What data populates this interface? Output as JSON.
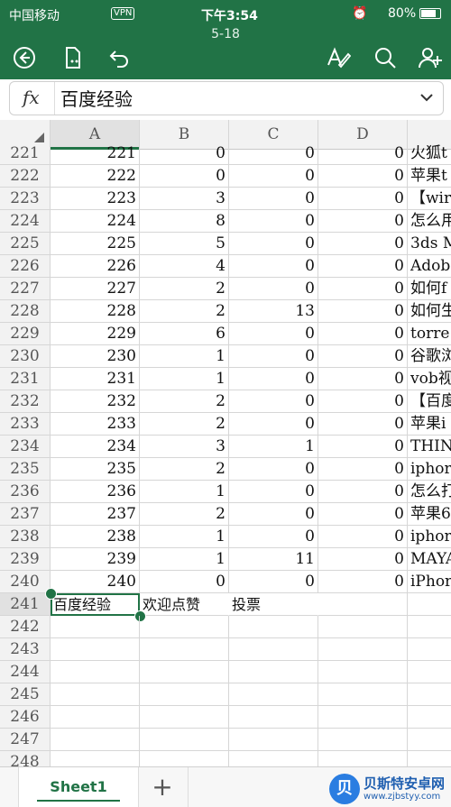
{
  "status_bar": {
    "carrier": "中国移动",
    "vpn": "VPN",
    "time": "下午3:54",
    "battery": "80%"
  },
  "document": {
    "title": "5-18"
  },
  "toolbar": {
    "back_icon": "back-circle-icon",
    "file_icon": "file-icon",
    "undo_icon": "undo-icon",
    "format_icon": "text-format-icon",
    "search_icon": "search-icon",
    "share_icon": "add-person-icon"
  },
  "formula_bar": {
    "fx": "fx",
    "value": "百度经验"
  },
  "columns": [
    "A",
    "B",
    "C",
    "D"
  ],
  "rows": [
    {
      "n": "221",
      "a": "221",
      "b": "0",
      "c": "0",
      "d": "0",
      "e": "火狐t"
    },
    {
      "n": "222",
      "a": "222",
      "b": "0",
      "c": "0",
      "d": "0",
      "e": "苹果t"
    },
    {
      "n": "223",
      "a": "223",
      "b": "3",
      "c": "0",
      "d": "0",
      "e": "【wir"
    },
    {
      "n": "224",
      "a": "224",
      "b": "8",
      "c": "0",
      "d": "0",
      "e": "怎么用"
    },
    {
      "n": "225",
      "a": "225",
      "b": "5",
      "c": "0",
      "d": "0",
      "e": "3ds M"
    },
    {
      "n": "226",
      "a": "226",
      "b": "4",
      "c": "0",
      "d": "0",
      "e": "Adobe"
    },
    {
      "n": "227",
      "a": "227",
      "b": "2",
      "c": "0",
      "d": "0",
      "e": "如何f"
    },
    {
      "n": "228",
      "a": "228",
      "b": "2",
      "c": "13",
      "d": "0",
      "e": "如何生"
    },
    {
      "n": "229",
      "a": "229",
      "b": "6",
      "c": "0",
      "d": "0",
      "e": "torre"
    },
    {
      "n": "230",
      "a": "230",
      "b": "1",
      "c": "0",
      "d": "0",
      "e": "谷歌浏"
    },
    {
      "n": "231",
      "a": "231",
      "b": "1",
      "c": "0",
      "d": "0",
      "e": "vob视"
    },
    {
      "n": "232",
      "a": "232",
      "b": "2",
      "c": "0",
      "d": "0",
      "e": "【百度"
    },
    {
      "n": "233",
      "a": "233",
      "b": "2",
      "c": "0",
      "d": "0",
      "e": "苹果i"
    },
    {
      "n": "234",
      "a": "234",
      "b": "3",
      "c": "1",
      "d": "0",
      "e": "THINK"
    },
    {
      "n": "235",
      "a": "235",
      "b": "2",
      "c": "0",
      "d": "0",
      "e": "iphor"
    },
    {
      "n": "236",
      "a": "236",
      "b": "1",
      "c": "0",
      "d": "0",
      "e": "怎么打"
    },
    {
      "n": "237",
      "a": "237",
      "b": "2",
      "c": "0",
      "d": "0",
      "e": "苹果6"
    },
    {
      "n": "238",
      "a": "238",
      "b": "1",
      "c": "0",
      "d": "0",
      "e": "iphor"
    },
    {
      "n": "239",
      "a": "239",
      "b": "1",
      "c": "11",
      "d": "0",
      "e": "MAYA"
    },
    {
      "n": "240",
      "a": "240",
      "b": "0",
      "c": "0",
      "d": "0",
      "e": "iPhor"
    },
    {
      "n": "241",
      "a": "百度经验",
      "b": "欢迎点赞",
      "c": "投票",
      "d": "",
      "e": ""
    },
    {
      "n": "242",
      "a": "",
      "b": "",
      "c": "",
      "d": "",
      "e": ""
    },
    {
      "n": "243",
      "a": "",
      "b": "",
      "c": "",
      "d": "",
      "e": ""
    },
    {
      "n": "244",
      "a": "",
      "b": "",
      "c": "",
      "d": "",
      "e": ""
    },
    {
      "n": "245",
      "a": "",
      "b": "",
      "c": "",
      "d": "",
      "e": ""
    },
    {
      "n": "246",
      "a": "",
      "b": "",
      "c": "",
      "d": "",
      "e": ""
    },
    {
      "n": "247",
      "a": "",
      "b": "",
      "c": "",
      "d": "",
      "e": ""
    },
    {
      "n": "248",
      "a": "",
      "b": "",
      "c": "",
      "d": "",
      "e": ""
    }
  ],
  "sheet_tabs": {
    "active": "Sheet1",
    "add": "+"
  },
  "watermark": {
    "name": "贝斯特安卓网",
    "url": "www.zjbstyy.com"
  },
  "colors": {
    "accent": "#217346"
  }
}
